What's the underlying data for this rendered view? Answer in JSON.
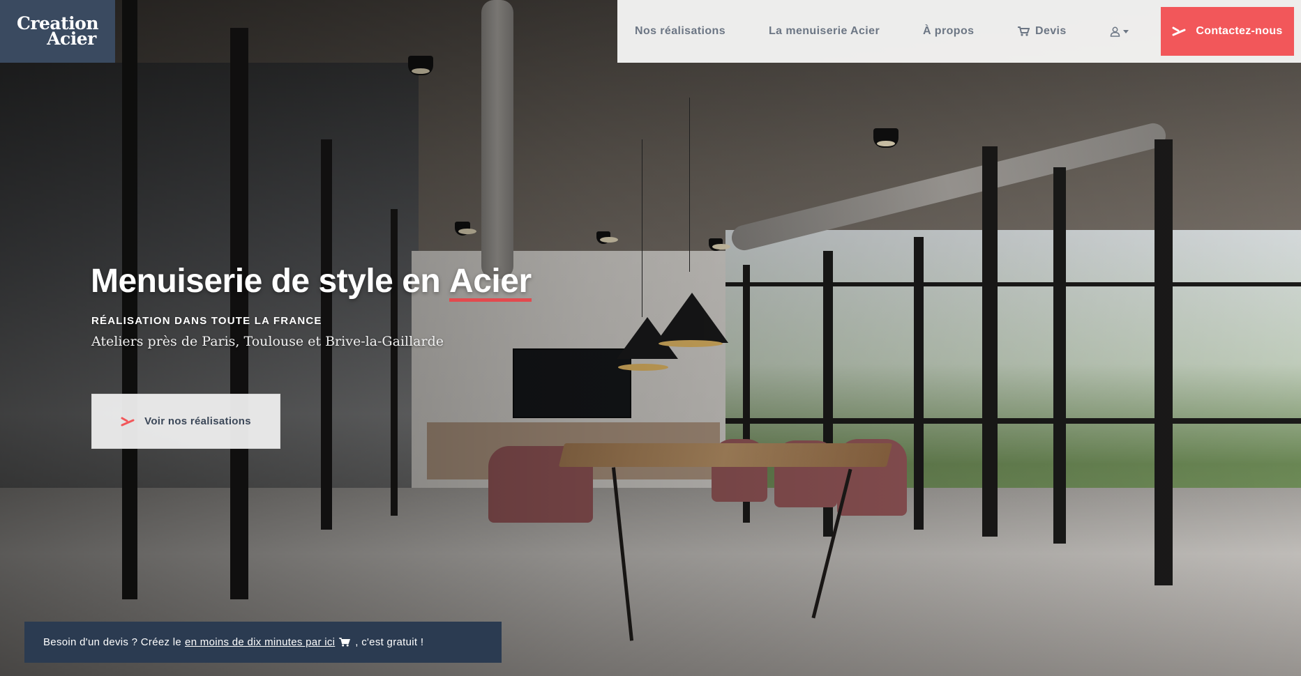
{
  "logo": {
    "line1": "Creation",
    "line2": "Acier"
  },
  "nav": {
    "items": [
      {
        "label": "Nos réalisations"
      },
      {
        "label": "La menuiserie Acier"
      },
      {
        "label": "À propos"
      },
      {
        "label": "Devis",
        "icon": "cart-icon"
      }
    ],
    "account_icon": "user-icon",
    "contact_label": "Contactez-nous"
  },
  "hero": {
    "title_prefix": "Menuiserie de style en",
    "title_accent": "Acier",
    "kicker": "RÉALISATION DANS TOUTE LA FRANCE",
    "subtitle": "Ateliers près de Paris, Toulouse et Brive-la-Gaillarde",
    "cta_label": "Voir nos réalisations"
  },
  "banner": {
    "before": "Besoin d'un devis ? Créez le",
    "link": "en moins de dix minutes par ici",
    "after": ", c'est gratuit !"
  },
  "colors": {
    "accent": "#f2575a",
    "navy": "#2b3b51",
    "nav_text": "#6c7684"
  }
}
